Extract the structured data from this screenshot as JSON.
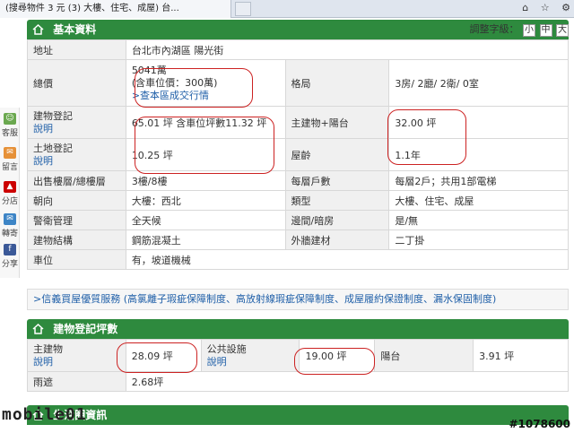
{
  "browser": {
    "tab_title": "(搜尋物件 3 元 (3) 大樓、住宅、成屋) 台...",
    "tools": [
      "⌂",
      "☆",
      "⚙"
    ]
  },
  "sidebar_tools": [
    {
      "icon": "person-icon",
      "label": "客服",
      "color": "#6aa84f"
    },
    {
      "icon": "chat-icon",
      "label": "留言",
      "color": "#e69138"
    },
    {
      "icon": "share-icon",
      "label": "分店",
      "color": "#cc0000"
    },
    {
      "icon": "mail-icon",
      "label": "轉寄",
      "color": "#3d85c6"
    },
    {
      "icon": "facebook-icon",
      "label": "分享",
      "color": "#3b5998"
    }
  ],
  "basic": {
    "title": "基本資料",
    "font_size_label": "調整字級：",
    "font_sizes": [
      "小",
      "中",
      "大"
    ],
    "rows": {
      "address_label": "地址",
      "address": "台北市內湖區 陽光街",
      "price_label": "總價",
      "price": "5041萬",
      "price_note": "(含車位價：300萬)",
      "price_link": ">查本區成交行情",
      "layout_label": "格局",
      "layout": "3房/ 2廳/ 2衛/ 0室",
      "building_label": "建物登記",
      "explain": "說明",
      "building": "65.01 坪 含車位坪數11.32 坪",
      "main_label": "主建物+陽台",
      "main": "32.00 坪",
      "land_label": "土地登記",
      "land": "10.25 坪",
      "age_label": "屋齡",
      "age": "1.1年",
      "floor_label": "出售樓層/總樓層",
      "floor": "3樓/8樓",
      "units_label": "每層戶數",
      "units": "每層2戶；共用1部電梯",
      "facing_label": "朝向",
      "facing": "大樓：西北",
      "type_label": "類型",
      "type": "大樓、住宅、成屋",
      "mgmt_label": "警衛管理",
      "mgmt": "全天候",
      "lane_label": "邊間/暗房",
      "lane": "是/無",
      "struct_label": "建物結構",
      "struct": "鋼筋混凝土",
      "wall_label": "外牆建材",
      "wall": "二丁掛",
      "parking_label": "車位",
      "parking": "有，坡道機械"
    }
  },
  "notice": ">信義買屋優質服務 (高氯離子瑕疵保障制度、高放射線瑕疵保障制度、成屋履約保證制度、漏水保固制度)",
  "registration": {
    "title": "建物登記坪數",
    "main_label": "主建物",
    "explain": "說明",
    "main": "28.09 坪",
    "public_label": "公共設施",
    "public": "19.00 坪",
    "balcony_label": "陽台",
    "balcony": "3.91 坪",
    "shelter_label": "雨遮",
    "shelter": "2.68坪"
  },
  "life": {
    "title": "生活圈資訊"
  },
  "watermark": {
    "logo": "mobile01",
    "post_id": "#1078600"
  }
}
